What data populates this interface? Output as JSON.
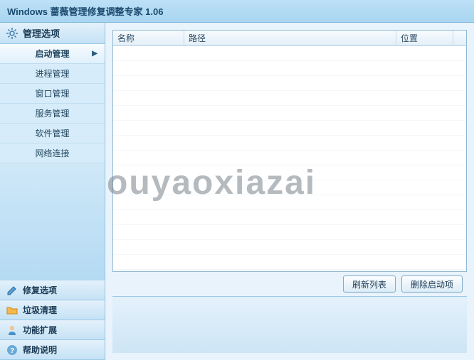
{
  "title": "Windows 蔷薇管理修复调整专家 1.06",
  "watermark": "ouyaoxiazai",
  "sidebar": {
    "main_section": {
      "label": "管理选项",
      "icon": "gear"
    },
    "items": [
      {
        "label": "启动管理",
        "active": true
      },
      {
        "label": "进程管理",
        "active": false
      },
      {
        "label": "窗口管理",
        "active": false
      },
      {
        "label": "服务管理",
        "active": false
      },
      {
        "label": "软件管理",
        "active": false
      },
      {
        "label": "网络连接",
        "active": false
      }
    ],
    "bottom": [
      {
        "label": "修复选项",
        "icon": "pencil"
      },
      {
        "label": "垃圾清理",
        "icon": "folder"
      },
      {
        "label": "功能扩展",
        "icon": "person"
      },
      {
        "label": "帮助说明",
        "icon": "help"
      }
    ]
  },
  "table": {
    "columns": {
      "name": "名称",
      "path": "路径",
      "loc": "位置"
    },
    "rows": []
  },
  "buttons": {
    "refresh": "刷新列表",
    "delete": "删除启动项"
  }
}
